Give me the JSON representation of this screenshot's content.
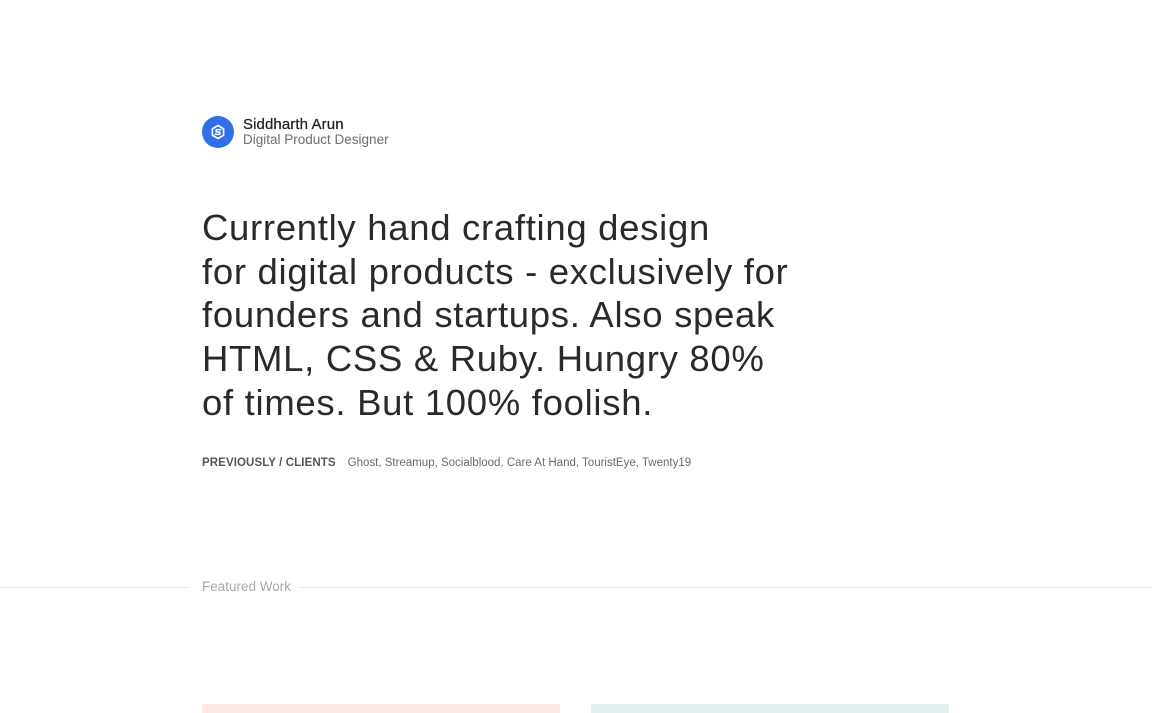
{
  "profile": {
    "name": "Siddharth Arun",
    "role": "Digital Product Designer",
    "avatar_icon": "logo-mark-icon",
    "avatar_color": "#2f6fe8"
  },
  "hero": {
    "lines": [
      "Currently hand crafting design",
      "for digital products - exclusively for",
      "founders and startups. Also speak",
      "HTML, CSS & Ruby. Hungry 80%",
      "of times. But 100% foolish."
    ]
  },
  "clients": {
    "label": "PREVIOUSLY / CLIENTS",
    "list": "Ghost, Streamup, Socialblood, Care At Hand, TouristEye, Twenty19"
  },
  "featured": {
    "title": "Featured Work",
    "cards": [
      {
        "color": "#fde8e8"
      },
      {
        "color": "#e3f2f0"
      }
    ]
  }
}
